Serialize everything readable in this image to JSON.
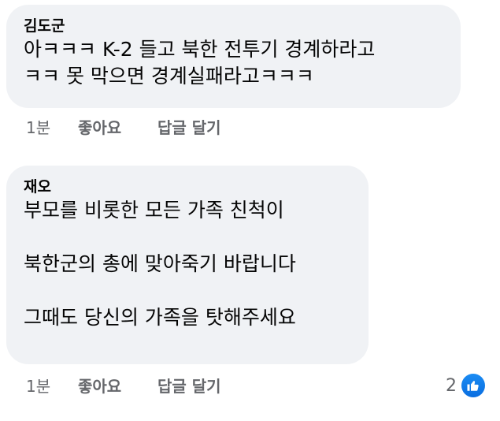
{
  "comments": [
    {
      "author": "김도군",
      "lines": [
        "아ㅋㅋㅋ K-2 들고 북한 전투기 경계하라고",
        "ㅋㅋ 못 막으면 경계실패라고ㅋㅋㅋ"
      ],
      "timestamp": "1분",
      "like_label": "좋아요",
      "reply_label": "답글 달기"
    },
    {
      "author": "재오",
      "lines": [
        "부모를 비롯한 모든 가족 친척이",
        "",
        "북한군의 총에 맞아죽기 바랍니다",
        "",
        "그때도 당신의 가족을 탓해주세요"
      ],
      "timestamp": "1분",
      "like_label": "좋아요",
      "reply_label": "답글 달기",
      "reaction_count": "2",
      "reaction_icon": "thumbs-up-icon",
      "reaction_color": "#1877f2"
    }
  ]
}
